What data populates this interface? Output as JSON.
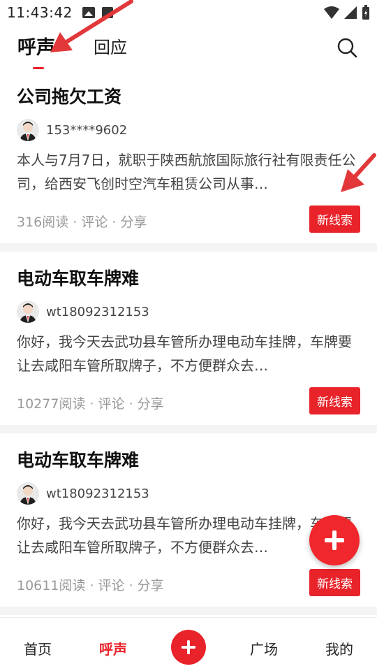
{
  "status_bar": {
    "time": "11:43:42"
  },
  "header": {
    "tabs": [
      {
        "label": "呼声"
      },
      {
        "label": "回应"
      }
    ]
  },
  "feed": [
    {
      "title": "公司拖欠工资",
      "author": "153****9602",
      "body": "本人与7月7日，就职于陕西航旅国际旅行社有限责任公司，给西安飞创时空汽车租赁公司从事…",
      "stats": "316阅读 · 评论 · 分享",
      "action": "新线索"
    },
    {
      "title": "电动车取车牌难",
      "author": "wt18092312153",
      "body": "你好，我今天去武功县车管所办理电动车挂牌，车牌要让去咸阳车管所取牌子，不方便群众去…",
      "stats": "10277阅读 · 评论 · 分享",
      "action": "新线索"
    },
    {
      "title": "电动车取车牌难",
      "author": "wt18092312153",
      "body": "你好，我今天去武功县车管所办理电动车挂牌，车牌要让去咸阳车管所取牌子，不方便群众去…",
      "stats": "10611阅读 · 评论 · 分享",
      "action": "新线索"
    }
  ],
  "bottom_nav": {
    "home": "首页",
    "voice": "呼声",
    "square": "广场",
    "mine": "我的"
  },
  "colors": {
    "accent": "#e8232a",
    "annotation": "#e2383a"
  },
  "icons": [
    "image-icon",
    "document-icon",
    "wifi-icon",
    "signal-icon",
    "battery-icon",
    "search-icon",
    "plus-icon",
    "avatar-icon"
  ]
}
